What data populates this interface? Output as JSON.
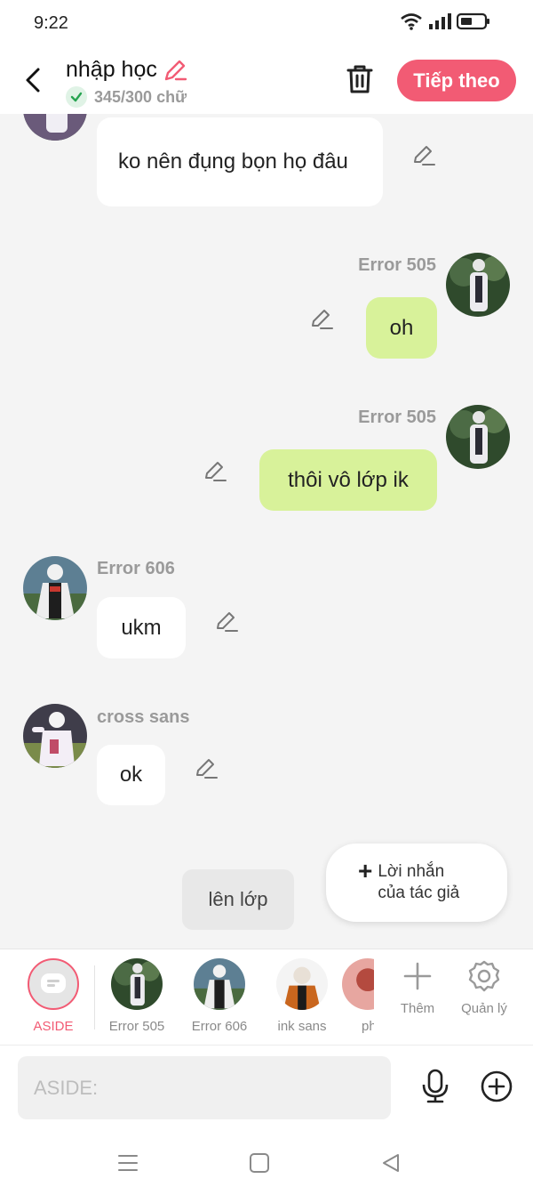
{
  "status_bar": {
    "time": "9:22"
  },
  "header": {
    "title": "nhập học",
    "word_count": "345/300 chữ",
    "next_label": "Tiếp theo"
  },
  "messages": [
    {
      "side": "left",
      "sender": "",
      "text": "ko nên đụng bọn họ đâu"
    },
    {
      "side": "right",
      "sender": "Error 505",
      "text": "oh"
    },
    {
      "side": "right",
      "sender": "Error 505",
      "text": "thôi vô lớp ik"
    },
    {
      "side": "left",
      "sender": "Error 606",
      "text": "ukm"
    },
    {
      "side": "left",
      "sender": "cross sans",
      "text": "ok"
    }
  ],
  "narration": "lên lớp",
  "author_note": {
    "line1": "Lời nhắn",
    "line2": "của tác giả"
  },
  "characters": [
    {
      "name": "ASIDE",
      "selected": true
    },
    {
      "name": "Error 505"
    },
    {
      "name": "Error 606"
    },
    {
      "name": "ink sans"
    },
    {
      "name": "ph"
    }
  ],
  "tools": {
    "add_label": "Thêm",
    "manage_label": "Quản lý"
  },
  "input": {
    "placeholder": "ASIDE:"
  },
  "colors": {
    "accent": "#f25b74",
    "my_bubble": "#d8f29a",
    "background": "#f4f4f4"
  }
}
